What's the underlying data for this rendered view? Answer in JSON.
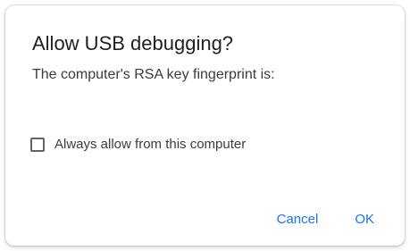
{
  "dialog": {
    "title": "Allow USB debugging?",
    "message": "The computer's RSA key fingerprint is:",
    "checkbox": {
      "label": "Always allow from this computer",
      "checked": false
    },
    "buttons": {
      "cancel": "Cancel",
      "ok": "OK"
    }
  },
  "colors": {
    "accent": "#1a73e8",
    "title_text": "#1f1f1f",
    "body_text": "#3c3c3c",
    "checkbox_border": "#5f6368",
    "background": "#ffffff"
  }
}
